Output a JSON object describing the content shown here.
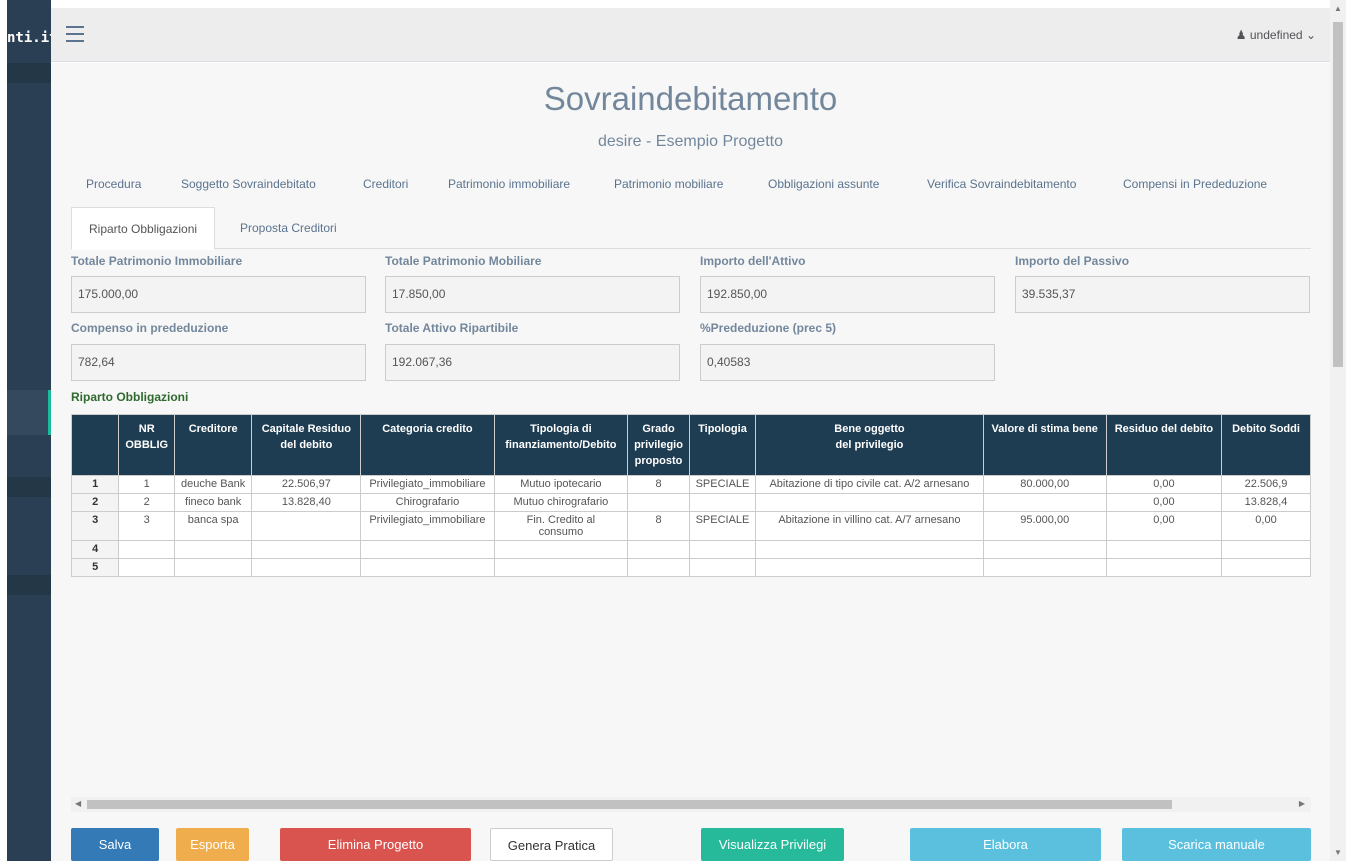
{
  "app": {
    "brand_fragment": "nti.it",
    "user": "undefined"
  },
  "header": {
    "title": "Sovraindebitamento",
    "subtitle": "desire - Esempio Progetto"
  },
  "nav": {
    "main_tabs": [
      "Procedura",
      "Soggetto Sovraindebitato",
      "Creditori",
      "Patrimonio immobiliare",
      "Patrimonio mobiliare",
      "Obbligazioni assunte",
      "Verifica Sovraindebitamento",
      "Compensi in Prededuzione"
    ],
    "sub_tabs": [
      {
        "label": "Riparto Obbligazioni",
        "active": true
      },
      {
        "label": "Proposta Creditori",
        "active": false
      }
    ]
  },
  "fields": {
    "totale_immobiliare": {
      "label": "Totale Patrimonio Immobiliare",
      "value": "175.000,00"
    },
    "totale_mobiliare": {
      "label": "Totale Patrimonio Mobiliare",
      "value": "17.850,00"
    },
    "importo_attivo": {
      "label": "Importo dell'Attivo",
      "value": "192.850,00"
    },
    "importo_passivo": {
      "label": "Importo del Passivo",
      "value": "39.535,37"
    },
    "compenso_prededuzione": {
      "label": "Compenso in prededuzione",
      "value": "782,64"
    },
    "attivo_ripartibile": {
      "label": "Totale Attivo Ripartibile",
      "value": "192.067,36"
    },
    "perc_prededuzione": {
      "label": "%Prededuzione (prec 5)",
      "value": "0,40583"
    }
  },
  "section_title": "Riparto Obbligazioni",
  "table": {
    "headers": [
      "",
      "NR\nOBBLIG",
      "Creditore",
      "Capitale Residuo\ndel debito",
      "Categoria credito",
      "Tipologia di\nfinanziamento/Debito",
      "Grado\nprivilegio\nproposto",
      "Tipologia",
      "Bene oggetto\ndel privilegio",
      "Valore di stima bene",
      "Residuo del debito",
      "Debito Soddi"
    ],
    "rows": [
      [
        "1",
        "1",
        "deuche Bank",
        "22.506,97",
        "Privilegiato_immobiliare",
        "Mutuo ipotecario",
        "8",
        "SPECIALE",
        "Abitazione di tipo civile cat. A/2 arnesano",
        "80.000,00",
        "0,00",
        "22.506,9"
      ],
      [
        "2",
        "2",
        "fineco bank",
        "13.828,40",
        "Chirografario",
        "Mutuo chirografario",
        "",
        "",
        "",
        "",
        "0,00",
        "13.828,4"
      ],
      [
        "3",
        "3",
        "banca spa",
        "",
        "Privilegiato_immobiliare",
        "Fin. Credito al\nconsumo",
        "8",
        "SPECIALE",
        "Abitazione in villino cat. A/7 arnesano",
        "95.000,00",
        "0,00",
        "0,00"
      ],
      [
        "4",
        "",
        "",
        "",
        "",
        "",
        "",
        "",
        "",
        "",
        "",
        ""
      ],
      [
        "5",
        "",
        "",
        "",
        "",
        "",
        "",
        "",
        "",
        "",
        "",
        ""
      ]
    ]
  },
  "buttons": [
    {
      "label": "Salva",
      "color": "#337ab7"
    },
    {
      "label": "Esporta",
      "color": "#f0ad4e"
    },
    {
      "label": "Elimina Progetto",
      "color": "#d9534f"
    },
    {
      "label": "Genera Pratica",
      "color": "#ffffff"
    },
    {
      "label": "Visualizza Privilegi",
      "color": "#26b99a"
    },
    {
      "label": "Elabora",
      "color": "#5bc0de"
    },
    {
      "label": "Scarica manuale",
      "color": "#5bc0de"
    }
  ],
  "colors": {
    "sidebar": "#2a3f54",
    "accent": "#1abb9c",
    "table_header": "#1f3d52"
  }
}
